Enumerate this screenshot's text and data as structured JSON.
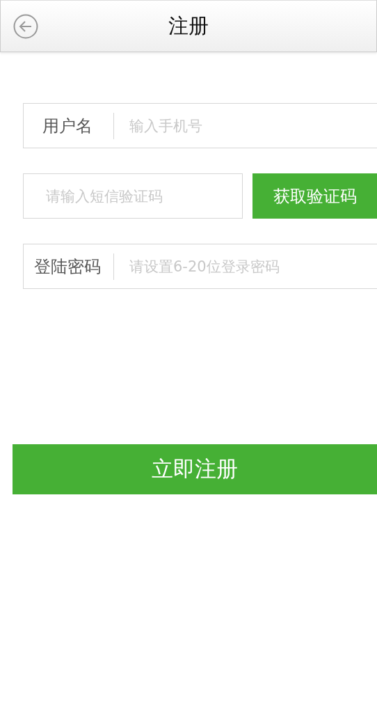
{
  "header": {
    "title": "注册"
  },
  "form": {
    "fields": [
      {
        "kind": "labeled",
        "label": "用户名",
        "placeholder": "输入手机号"
      },
      {
        "kind": "code",
        "placeholder": "请输入短信验证码",
        "button": "获取验证码"
      },
      {
        "kind": "labeled",
        "label": "登陆密码",
        "placeholder": "请设置6-20位登录密码"
      }
    ]
  },
  "submit": "立即注册"
}
